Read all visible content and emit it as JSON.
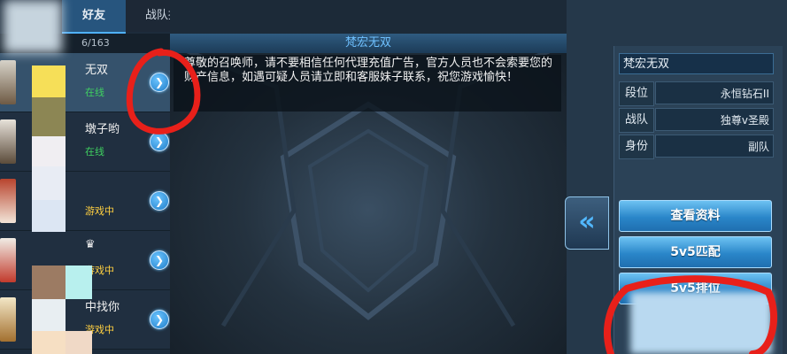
{
  "tabs": [
    {
      "label": "好友"
    },
    {
      "label": "战队招募"
    }
  ],
  "friend_count": "6/163",
  "friends": [
    {
      "name": "无双",
      "status": "在线",
      "status_color": "green"
    },
    {
      "name": "墩子哟",
      "status": "在线",
      "status_color": "green"
    },
    {
      "name": "",
      "status": "游戏中",
      "status_color": "orange"
    },
    {
      "name": "♛",
      "status": "游戏中",
      "status_color": "orange"
    },
    {
      "name": "中找你",
      "status": "游戏中",
      "status_color": "orange"
    }
  ],
  "chat": {
    "title": "梵宏无双",
    "notice": "尊敬的召唤师，请不要相信任何代理充值广告，官方人员也不会索要您的财产信息，如遇可疑人员请立即和客服妹子联系，祝您游戏愉快！"
  },
  "profile": {
    "name": "梵宏无双",
    "rows": [
      {
        "label": "段位",
        "value": "永恒钻石II"
      },
      {
        "label": "战队",
        "value": "独尊v圣殿"
      },
      {
        "label": "身份",
        "value": "副队"
      }
    ]
  },
  "actions": [
    {
      "label": "查看资料"
    },
    {
      "label": "5v5匹配"
    },
    {
      "label": "5v5排位"
    }
  ],
  "colors": {
    "accent": "#4fb1ff",
    "online": "#3fd060",
    "in_game": "#ffd040",
    "annotation_red": "#e8201a"
  }
}
